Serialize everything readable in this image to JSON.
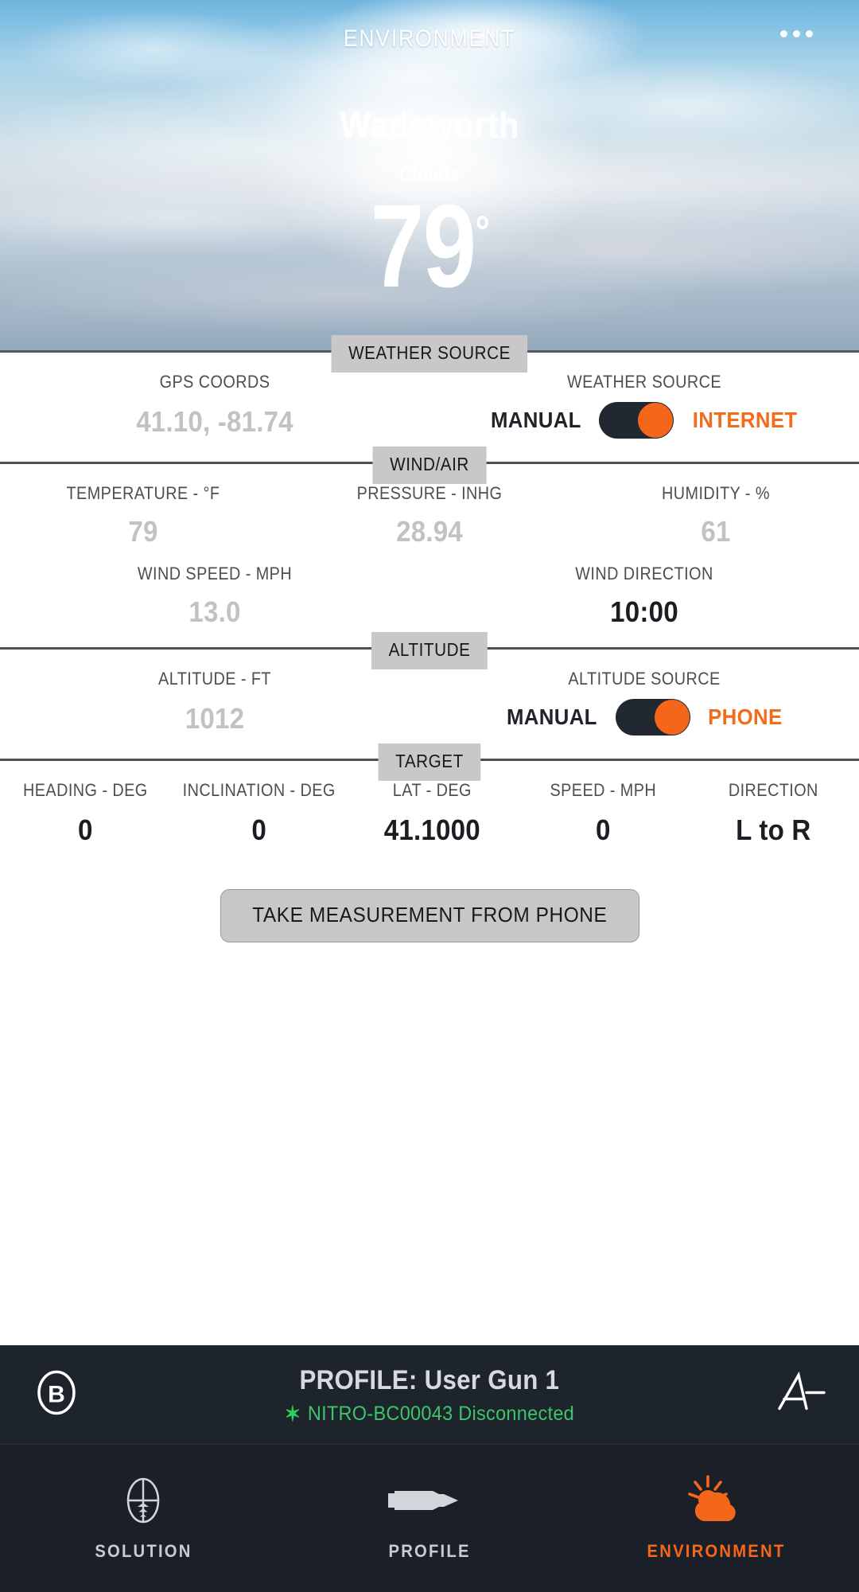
{
  "header": {
    "title": "ENVIRONMENT",
    "menu_icon": "more-options-icon",
    "city": "Wadsworth",
    "condition": "Clouds",
    "temperature": "79",
    "degree_symbol": "°"
  },
  "sections": {
    "weather_source": {
      "chip": "WEATHER SOURCE",
      "gps_label": "GPS COORDS",
      "gps_value": "41.10, -81.74",
      "source_label": "WEATHER SOURCE",
      "toggle_left": "MANUAL",
      "toggle_right": "INTERNET",
      "toggle_state": "right"
    },
    "wind_air": {
      "chip": "WIND/AIR",
      "temperature_label": "TEMPERATURE - °F",
      "temperature_value": "79",
      "pressure_label": "PRESSURE - INHG",
      "pressure_value": "28.94",
      "humidity_label": "HUMIDITY - %",
      "humidity_value": "61",
      "wind_speed_label": "WIND SPEED - MPH",
      "wind_speed_value": "13.0",
      "wind_direction_label": "WIND DIRECTION",
      "wind_direction_value": "10:00"
    },
    "altitude": {
      "chip": "ALTITUDE",
      "altitude_label": "ALTITUDE - FT",
      "altitude_value": "1012",
      "source_label": "ALTITUDE SOURCE",
      "toggle_left": "MANUAL",
      "toggle_right": "PHONE",
      "toggle_state": "right"
    },
    "target": {
      "chip": "TARGET",
      "columns": [
        {
          "label": "HEADING - DEG",
          "value": "0"
        },
        {
          "label": "INCLINATION - DEG",
          "value": "0"
        },
        {
          "label": "LAT - DEG",
          "value": "41.1000"
        },
        {
          "label": "SPEED - MPH",
          "value": "0"
        },
        {
          "label": "DIRECTION",
          "value": "L to R"
        }
      ]
    }
  },
  "action_button": {
    "label": "TAKE MEASUREMENT FROM PHONE"
  },
  "profile_bar": {
    "logo_letter": "B",
    "profile_text": "PROFILE: User Gun 1",
    "bluetooth_icon": "bluetooth-icon",
    "bluetooth_status": "NITRO-BC00043 Disconnected",
    "brand_logo": "applied-ballistics-logo"
  },
  "bottom_nav": {
    "items": [
      {
        "label": "SOLUTION",
        "icon": "scope-reticle-icon",
        "active": false
      },
      {
        "label": "PROFILE",
        "icon": "bullet-cartridge-icon",
        "active": false
      },
      {
        "label": "ENVIRONMENT",
        "icon": "sun-cloud-icon",
        "active": true
      }
    ]
  },
  "colors": {
    "accent": "#f4671a",
    "dark": "#1e242c",
    "bluetooth_green": "#3ec46a",
    "chip_gray": "#c8c8c8",
    "dim_value": "#c2c2c2"
  }
}
